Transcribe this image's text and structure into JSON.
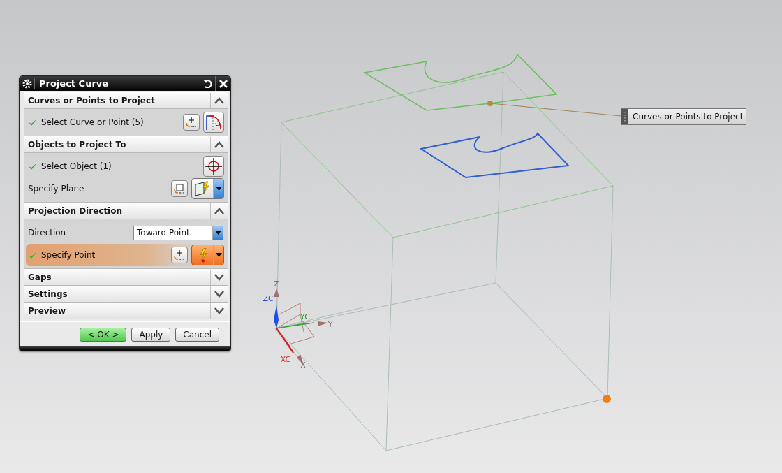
{
  "dialog": {
    "title": "Project Curve",
    "sections": [
      {
        "title": "Curves or Points to Project",
        "expanded": true,
        "rows": [
          {
            "kind": "curve-select",
            "label": "Select Curve or Point (5)",
            "complete": true,
            "highlighted": false
          }
        ]
      },
      {
        "title": "Objects to Project To",
        "expanded": true,
        "rows": [
          {
            "kind": "object-select",
            "label": "Select Object (1)",
            "complete": true,
            "highlighted": false
          },
          {
            "kind": "plane",
            "label": "Specify Plane",
            "complete": false,
            "highlighted": false
          }
        ]
      },
      {
        "title": "Projection Direction",
        "expanded": true,
        "rows": [
          {
            "kind": "dropdown",
            "label": "Direction",
            "value": "Toward Point"
          },
          {
            "kind": "point",
            "label": "Specify Point",
            "complete": true,
            "highlighted": true
          }
        ]
      },
      {
        "title": "Gaps",
        "expanded": false
      },
      {
        "title": "Settings",
        "expanded": false
      },
      {
        "title": "Preview",
        "expanded": false
      }
    ],
    "buttons": [
      {
        "label": "< OK >",
        "default": true
      },
      {
        "label": "Apply",
        "default": false
      },
      {
        "label": "Cancel",
        "default": false
      }
    ]
  },
  "viewport": {
    "axis_labels": [
      {
        "label": "Z",
        "color": "#8a6a6a"
      },
      {
        "label": "ZC",
        "color": "#1f4fe0"
      },
      {
        "label": "YC",
        "color": "#2a9a2a"
      },
      {
        "label": "Y",
        "color": "#8a6a6a"
      },
      {
        "label": "XC",
        "color": "#d02020"
      },
      {
        "label": "X",
        "color": "#8a6a6a"
      }
    ],
    "callout": "Curves or Points to Project"
  }
}
